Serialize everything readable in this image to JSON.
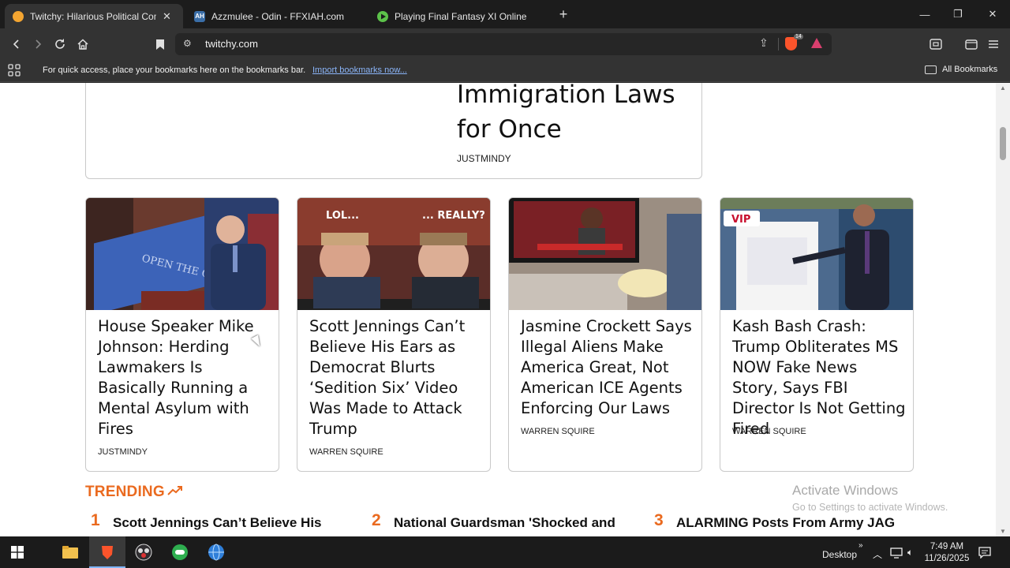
{
  "tabs": [
    {
      "title": "Twitchy: Hilarious Political Comm",
      "favicon_color": "#f3a531",
      "active": true
    },
    {
      "title": "Azzmulee - Odin - FFXIAH.com",
      "favicon_text": "AH",
      "favicon_color": "#3a6ea8",
      "active": false
    },
    {
      "title": "Playing Final Fantasy XI Online",
      "favicon_color": "#5cc24a",
      "active": false
    }
  ],
  "toolbar": {
    "url": "twitchy.com",
    "shield_count": "14"
  },
  "bookmarks_bar": {
    "message": "For quick access, place your bookmarks here on the bookmarks bar.",
    "import_link": "Import bookmarks now...",
    "all_bookmarks": "All Bookmarks"
  },
  "top_article": {
    "headline": "Immigration Laws for Once",
    "author": "JUSTMINDY"
  },
  "articles": [
    {
      "headline": "House Speaker Mike Johnson: Herding Lawmakers Is Basically Running a Mental Asylum with Fires",
      "author": "JUSTMINDY",
      "image_text": "OPEN THE GOVERNMENT"
    },
    {
      "headline": "Scott Jennings Can’t Believe His Ears as Democrat Blurts ‘Sedition Six’ Video Was Made to Attack Trump",
      "author": "WARREN SQUIRE",
      "image_text_left": "LOL...",
      "image_text_right": "... REALLY?"
    },
    {
      "headline": "Jasmine Crockett Says Illegal Aliens Make America Great, Not American ICE Agents Enforcing Our Laws",
      "author": "WARREN SQUIRE"
    },
    {
      "headline": "Kash Bash Crash: Trump Obliterates MS NOW Fake News Story, Says FBI Director Is Not Getting Fired",
      "author": "WARREN SQUIRE",
      "badge": "VIP"
    }
  ],
  "trending": {
    "title": "TRENDING",
    "items": [
      {
        "num": "1",
        "text": "Scott Jennings Can’t Believe His Ears"
      },
      {
        "num": "2",
        "text": "National Guardsman 'Shocked and"
      },
      {
        "num": "3",
        "text": "ALARMING Posts From Army JAG"
      }
    ]
  },
  "watermark": {
    "title": "Activate Windows",
    "subtitle": "Go to Settings to activate Windows."
  },
  "taskbar": {
    "desktop_label": "Desktop",
    "time": "7:49 AM",
    "date": "11/26/2025"
  },
  "colors": {
    "accent_orange": "#ea6a1f",
    "link_blue": "#8ab4f8"
  }
}
